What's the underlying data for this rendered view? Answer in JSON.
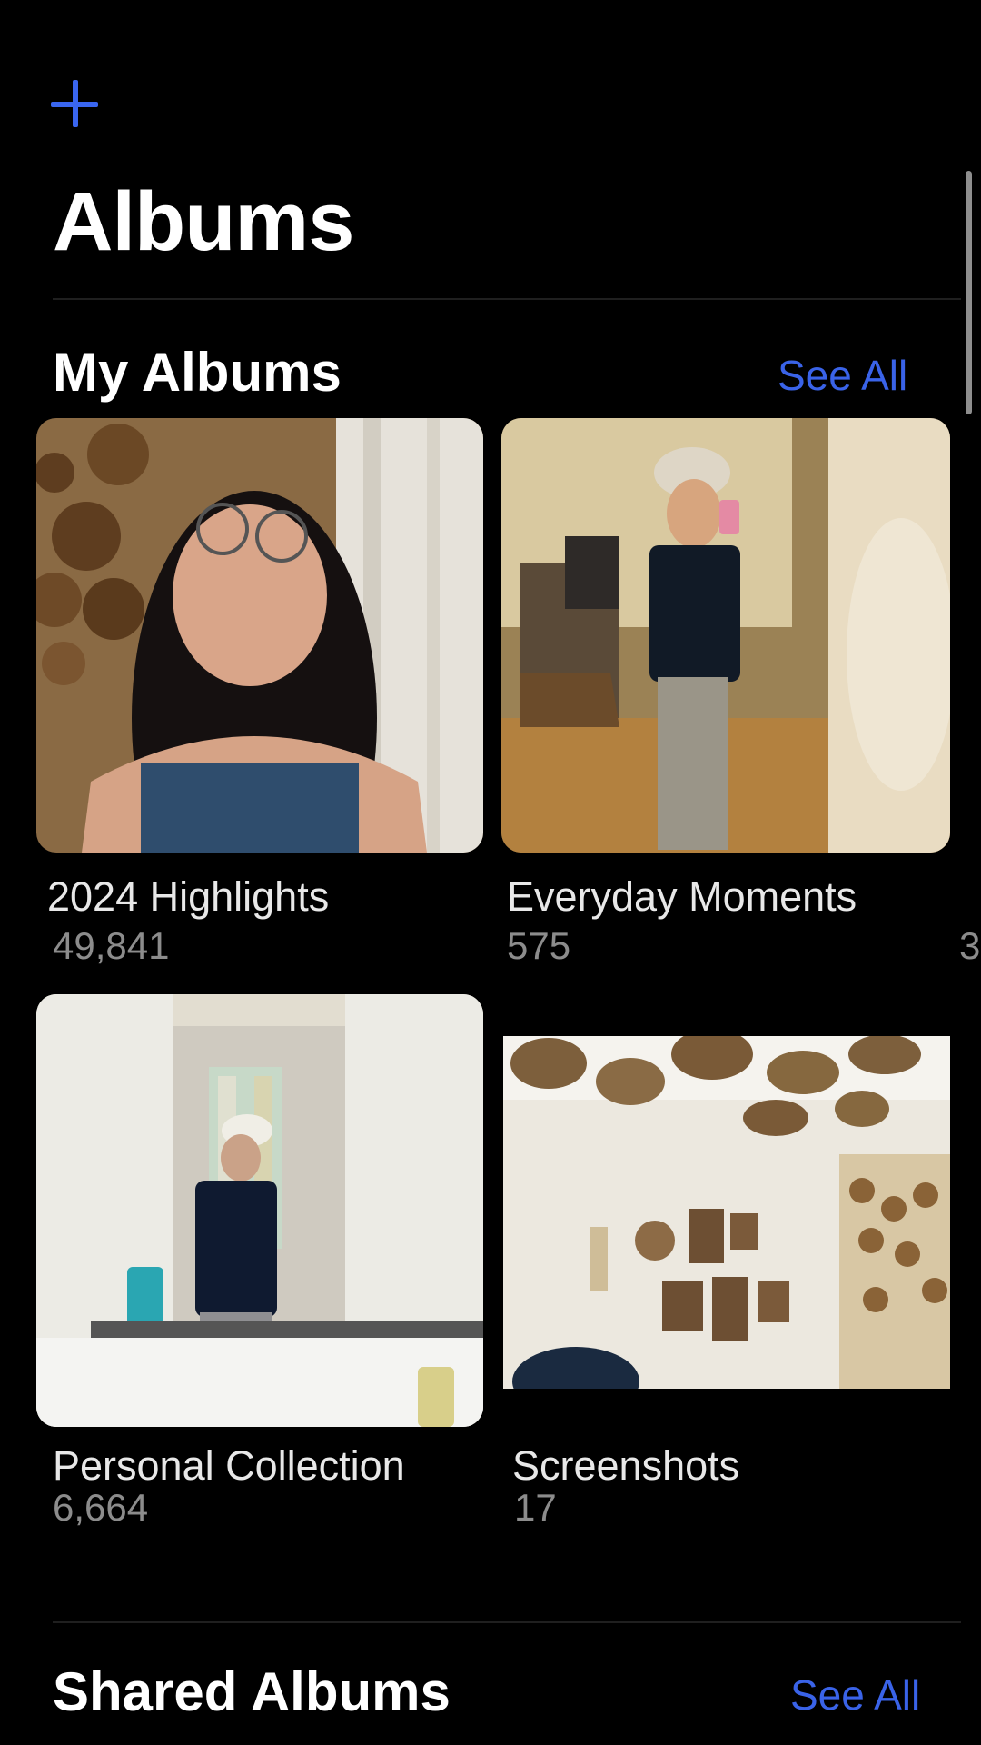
{
  "header": {
    "title": "Albums",
    "add_icon": "plus-icon",
    "accent": "#3a66f0"
  },
  "my_albums": {
    "title": "My Albums",
    "see_all": "See All",
    "items": [
      {
        "name": "2024 Highlights",
        "count": "49,841"
      },
      {
        "name": "Everyday Moments",
        "count": "575"
      },
      {
        "name": "Personal Collection",
        "count": "6,664"
      },
      {
        "name": "Screenshots",
        "count": "17"
      }
    ],
    "peek_count": "3"
  },
  "shared_albums": {
    "title": "Shared Albums",
    "see_all": "See All"
  }
}
